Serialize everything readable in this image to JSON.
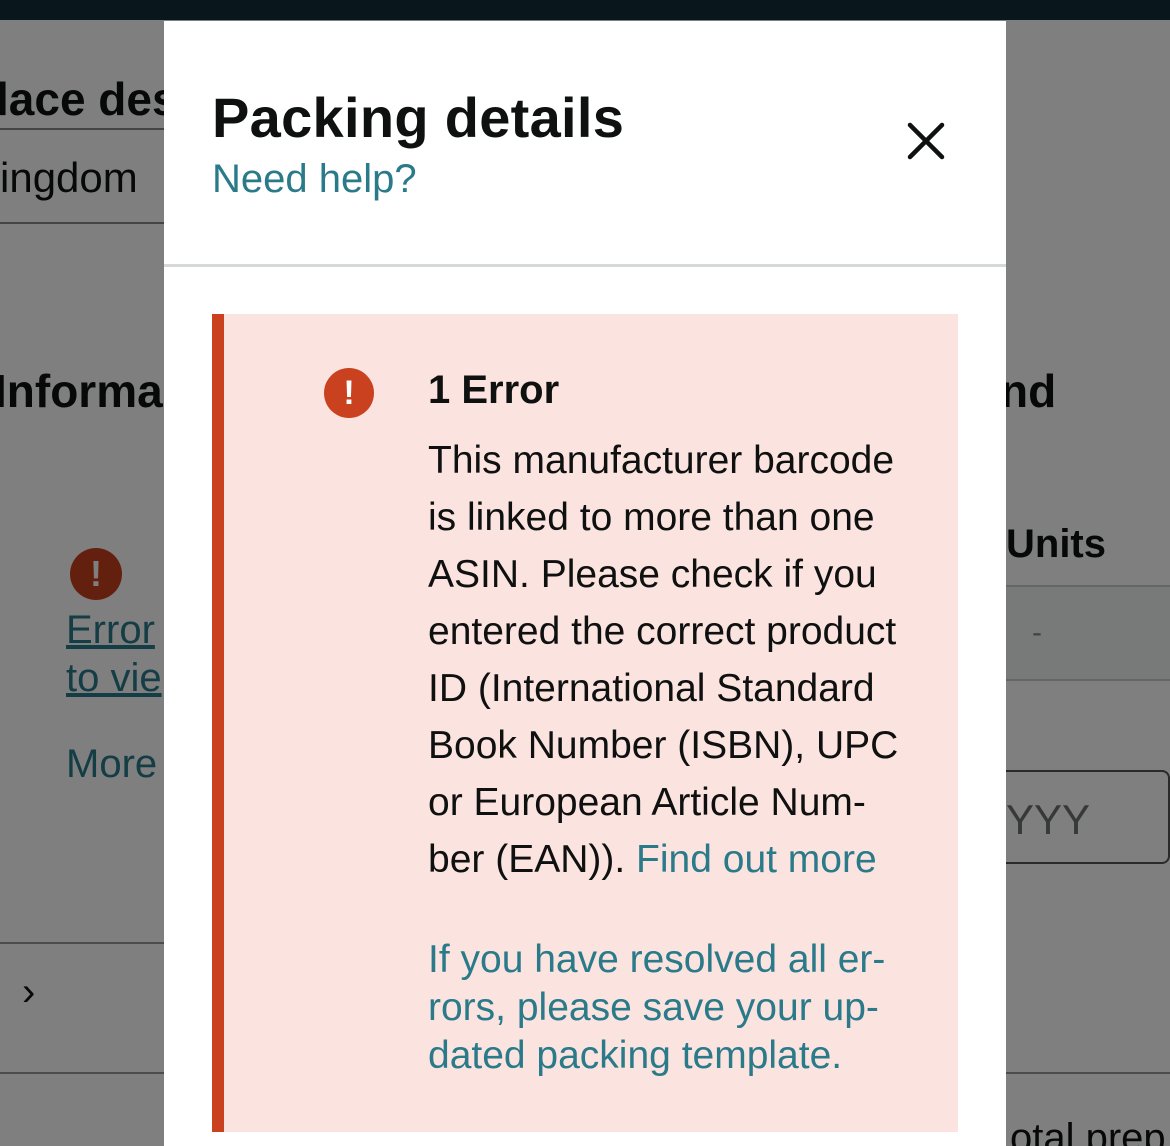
{
  "background": {
    "title_fragment": "lace des",
    "country_fragment": "ingdom",
    "section_fragment": "Informa",
    "error_link_line1": "Error",
    "error_link_line2": "to vie",
    "more_link": "More",
    "right_heading_fragment": "nd",
    "units_header": "Units",
    "empty_cell": "-",
    "date_placeholder": "YYY",
    "total_fragment": "otal prep"
  },
  "modal": {
    "title": "Packing details",
    "help_link": "Need help?",
    "close_icon": "close-icon"
  },
  "alert": {
    "icon": "exclamation-icon",
    "heading": "1 Error",
    "body_lines": [
      "This manufacturer barcode",
      "is linked to more than one",
      "ASIN. Please check if you",
      "entered the correct product",
      "ID (International Standard",
      "Book Number (ISBN), UPC",
      "or European Article Num-",
      "ber (EAN))."
    ],
    "find_out_more": "Find out more",
    "note_lines": [
      "If you have resolved all er-",
      "rors, please save your up-",
      "dated packing template."
    ]
  },
  "colors": {
    "error_red": "#c9411f",
    "alert_background": "#fbe3df",
    "link_teal": "#2a7a8a",
    "header_bar": "#132d38"
  }
}
